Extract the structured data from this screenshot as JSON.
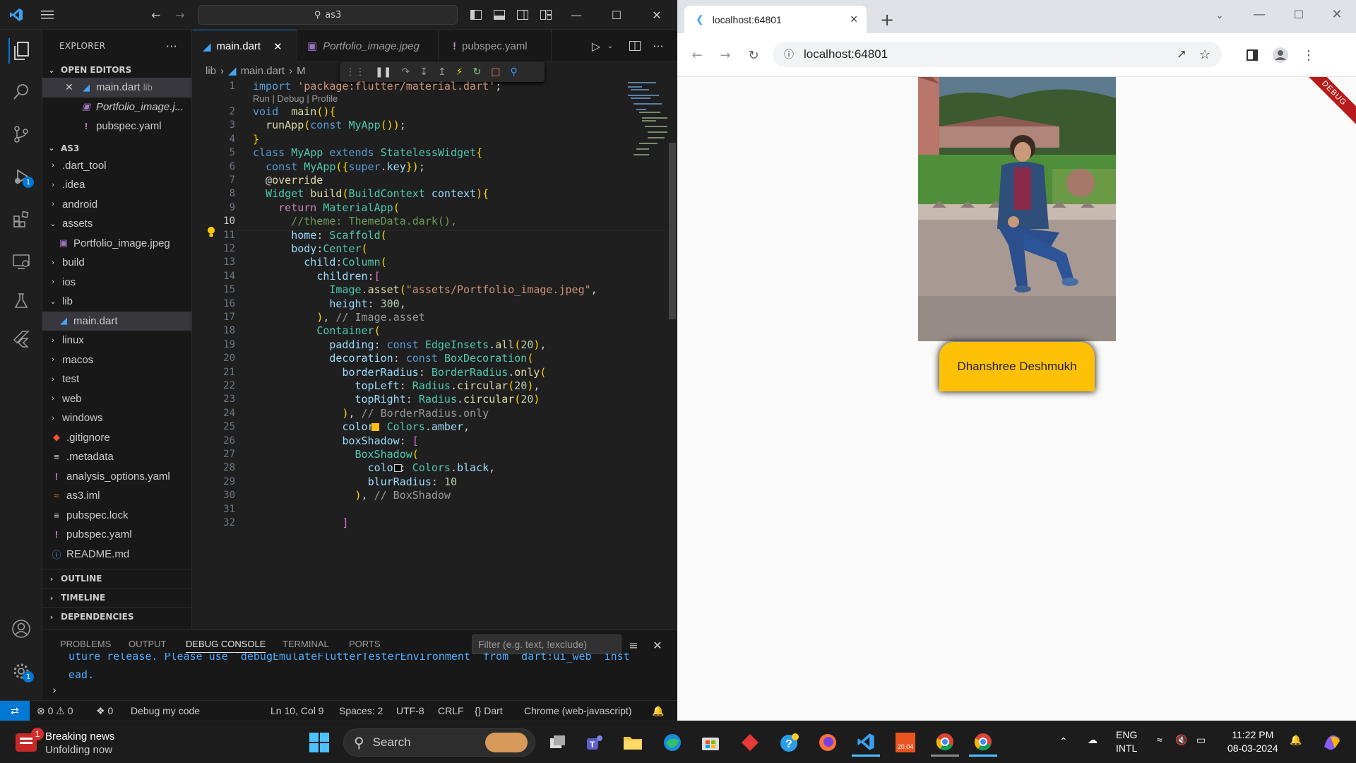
{
  "vscode": {
    "search_text": "as3",
    "explorer_title": "EXPLORER",
    "open_editors_label": "OPEN EDITORS",
    "open_editors": [
      {
        "name": "main.dart",
        "detail": "lib"
      },
      {
        "name": "Portfolio_image.j..."
      },
      {
        "name": "pubspec.yaml"
      }
    ],
    "project_label": "AS3",
    "tree": [
      {
        "label": ".dart_tool",
        "kind": "folder"
      },
      {
        "label": ".idea",
        "kind": "folder"
      },
      {
        "label": "android",
        "kind": "folder"
      },
      {
        "label": "assets",
        "kind": "folder-open"
      },
      {
        "label": "Portfolio_image.jpeg",
        "kind": "image"
      },
      {
        "label": "build",
        "kind": "folder"
      },
      {
        "label": "ios",
        "kind": "folder"
      },
      {
        "label": "lib",
        "kind": "folder-open"
      },
      {
        "label": "main.dart",
        "kind": "dart"
      },
      {
        "label": "linux",
        "kind": "folder"
      },
      {
        "label": "macos",
        "kind": "folder"
      },
      {
        "label": "test",
        "kind": "folder"
      },
      {
        "label": "web",
        "kind": "folder"
      },
      {
        "label": "windows",
        "kind": "folder"
      },
      {
        "label": ".gitignore",
        "kind": "git"
      },
      {
        "label": ".metadata",
        "kind": "text"
      },
      {
        "label": "analysis_options.yaml",
        "kind": "yaml"
      },
      {
        "label": "as3.iml",
        "kind": "rss"
      },
      {
        "label": "pubspec.lock",
        "kind": "text"
      },
      {
        "label": "pubspec.yaml",
        "kind": "yaml"
      },
      {
        "label": "README.md",
        "kind": "info"
      }
    ],
    "outline_label": "OUTLINE",
    "timeline_label": "TIMELINE",
    "dependencies_label": "DEPENDENCIES",
    "tabs": [
      {
        "label": "main.dart"
      },
      {
        "label": "Portfolio_image.jpeg"
      },
      {
        "label": "pubspec.yaml"
      }
    ],
    "breadcrumb": [
      "lib",
      "main.dart",
      "M"
    ],
    "codelens": "Run | Debug | Profile",
    "line_numbers": [
      "1",
      "2",
      "3",
      "4",
      "5",
      "6",
      "7",
      "8",
      "9",
      "10",
      "11",
      "12",
      "13",
      "14",
      "15",
      "16",
      "17",
      "18",
      "19",
      "20",
      "21",
      "22",
      "23",
      "24",
      "25",
      "26",
      "27",
      "28",
      "29",
      "30",
      "31",
      "32"
    ],
    "code": [
      "import 'package:flutter/material.dart';",
      "void  main(){",
      "  runApp(const MyApp());",
      "}",
      "class MyApp extends StatelessWidget{",
      "  const MyApp({super.key});",
      "  @override",
      "  Widget build(BuildContext context){",
      "    return MaterialApp(",
      "      //theme: ThemeData.dark(),",
      "      home: Scaffold(",
      "      body:Center(",
      "        child:Column(",
      "          children:[",
      "            Image.asset(\"assets/Portfolio_image.jpeg\",",
      "            height: 300,",
      "          ), // Image.asset",
      "          Container(",
      "            padding: const EdgeInsets.all(20),",
      "            decoration: const BoxDecoration(",
      "              borderRadius: BorderRadius.only(",
      "                topLeft: Radius.circular(20),",
      "                topRight: Radius.circular(20)",
      "              ), // BorderRadius.only",
      "              color: Colors.amber,",
      "              boxShadow: [",
      "                BoxShadow(",
      "                  color: Colors.black,",
      "                  blurRadius: 10",
      "                ), // BoxShadow",
      "",
      "              ]"
    ],
    "panel_tabs": [
      "PROBLEMS",
      "OUTPUT",
      "DEBUG CONSOLE",
      "TERMINAL",
      "PORTS"
    ],
    "filter_placeholder": "Filter (e.g. text, !exclude)",
    "console_lines": [
      "uture release. Please use `debugEmulateFlutterTesterEnvironment` from `dart:ui_web` inst",
      "ead."
    ],
    "status": {
      "errors": "0",
      "warnings": "0",
      "ports": "0",
      "debug": "Debug my code",
      "position": "Ln 10, Col 9",
      "spaces": "Spaces: 2",
      "encoding": "UTF-8",
      "eol": "CRLF",
      "language": "Dart",
      "device": "Chrome (web-javascript)"
    },
    "badge_count": "1",
    "settings_badge": "1"
  },
  "chrome": {
    "tab_title": "localhost:64801",
    "url": "localhost:64801",
    "debug_banner": "DEBUG",
    "name_label": "Dhanshree Deshmukh",
    "amber_color": "#ffc107"
  },
  "taskbar": {
    "news_title": "Breaking news",
    "news_subtitle": "Unfolding now",
    "news_badge": "1",
    "search_placeholder": "Search",
    "lang_line1": "ENG",
    "lang_line2": "INTL",
    "time": "11:22 PM",
    "date": "08-03-2024",
    "ubuntu_label": "20.04"
  }
}
